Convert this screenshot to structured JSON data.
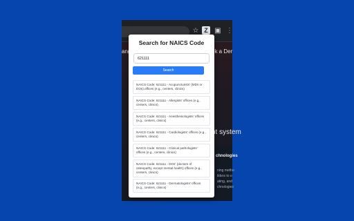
{
  "browser": {
    "extension_icon_label": "Z",
    "page_nav_left": "ange",
    "page_nav_right": "ok a Der",
    "page_heading": "nt system",
    "page_block_title": "chnologies",
    "page_block_lines": [
      "ning metho",
      "ilders to o",
      "ating, and",
      "chnologies"
    ]
  },
  "popup": {
    "title": "Search for NAICS Code",
    "search_value": "621111",
    "search_button": "Search",
    "results": [
      "NAICS Code: 621111 - Acupuncturists' (MDs or DOs) offices (e.g., centers, clinics)",
      "NAICS Code: 621111 - Allergists' offices (e.g., centers, clinics)",
      "NAICS Code: 621111 - Anesthesiologists' offices (e.g., centers, clinics)",
      "NAICS Code: 621111 - Cardiologists' offices (e.g., centers, clinics)",
      "NAICS Code: 621111 - Clinical pathologists' offices (e.g., centers, clinics)",
      "NAICS Code: 621111 - DOs' (doctors of osteopathy, except mental health) offices (e.g., centers, clinics)",
      "NAICS Code: 621111 - Dermatologists' offices (e.g., centers, clinics)"
    ]
  },
  "icons": {
    "star": "star-icon",
    "extension": "extension-icon",
    "puzzle": "puzzle-icon",
    "more": "more-icon"
  },
  "colors": {
    "background": "#0645ad",
    "button": "#2a7cf6"
  }
}
